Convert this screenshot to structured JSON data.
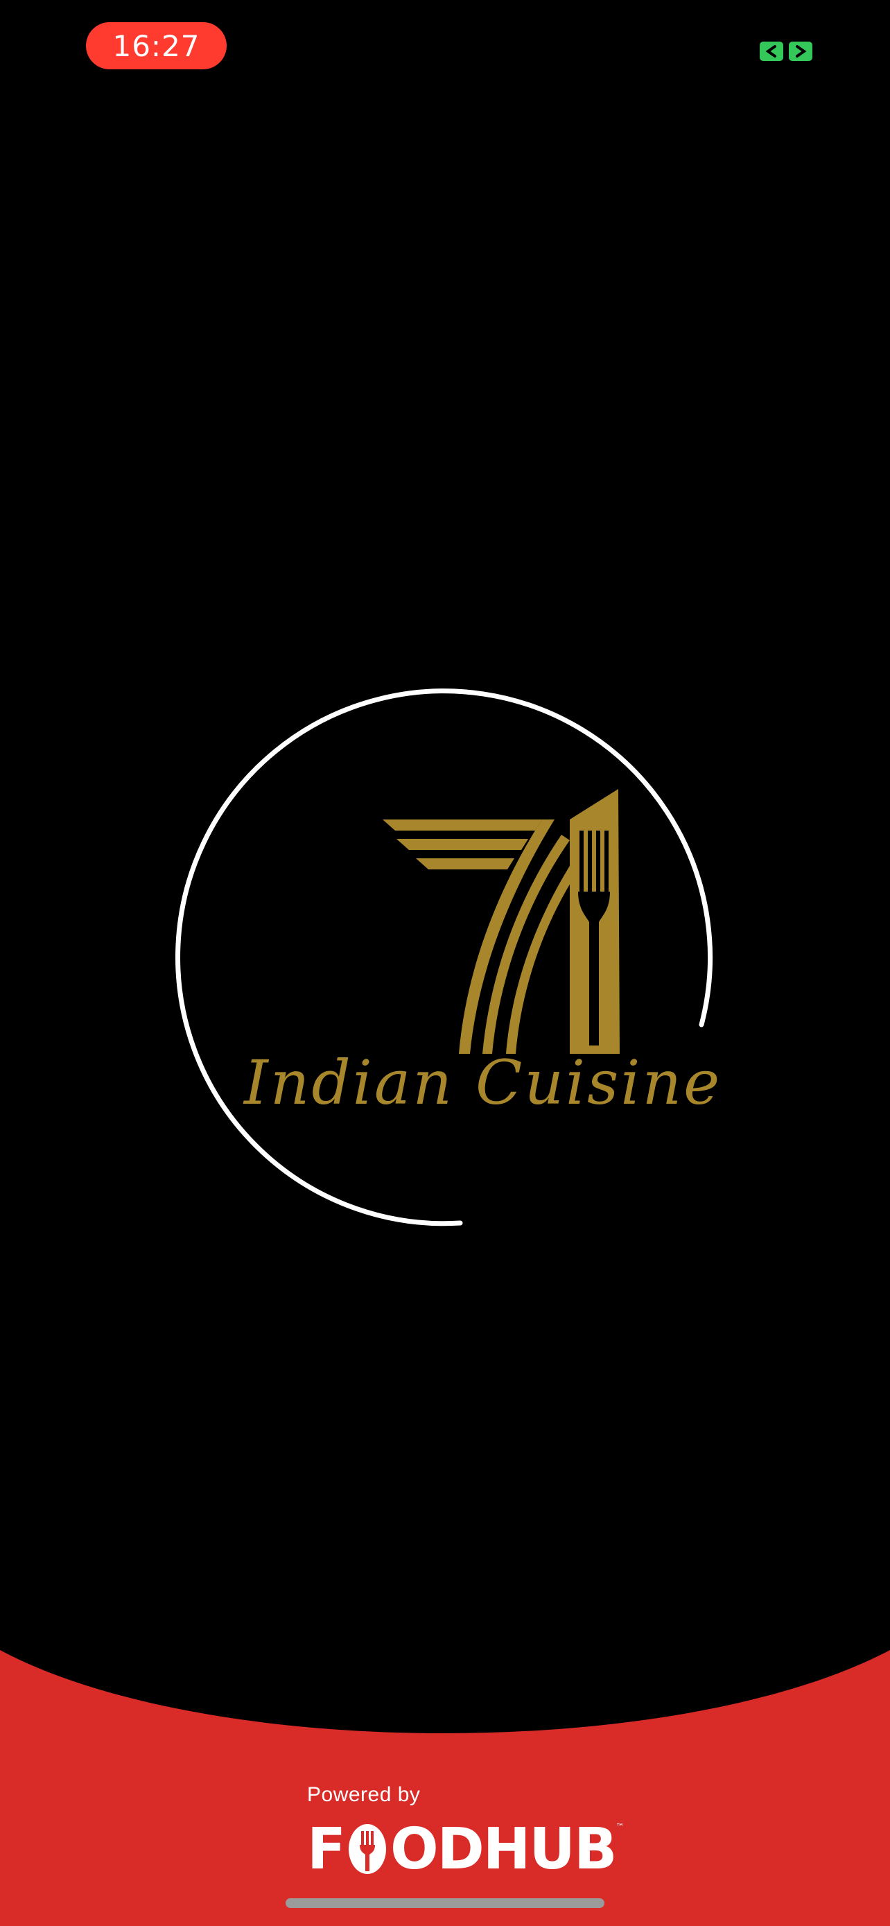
{
  "status_bar": {
    "time": "16:27",
    "time_pill_color": "#ff3b30",
    "right_icon": "screen-share-icon",
    "right_icon_color": "#34c759"
  },
  "logo": {
    "emblem_number": "71",
    "name": "Indian Cuisine",
    "emblem_icon": "fork-icon",
    "gold_color": "#a8872c",
    "ring_color": "#ffffff"
  },
  "footer": {
    "powered_by": "Powered by",
    "brand_left": "F",
    "brand_right": "ODHUB",
    "trademark": "™",
    "background_color": "#d92b27"
  }
}
